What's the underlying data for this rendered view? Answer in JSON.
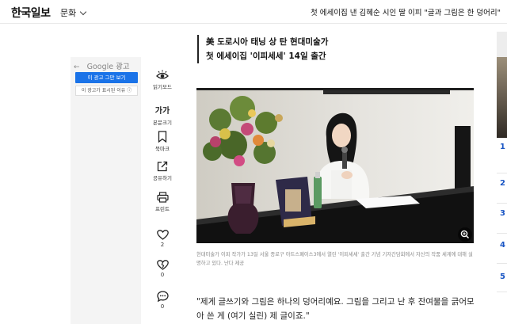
{
  "header": {
    "logo": "한국일보",
    "section": "문화",
    "headline": "첫 에세이집 낸 김혜순 시인 딸 이피 \"글과 그림은 한 덩어리\""
  },
  "ad": {
    "brand": "Google",
    "label": "광고",
    "stop_button": "이 광고 그만 보기",
    "why_button": "이 광고가 표시된 이유 ⓘ"
  },
  "tools": {
    "reading_mode": "읽기모드",
    "font_size_glyph": "가가",
    "font_size": "본문크기",
    "bookmark": "북마크",
    "share": "공유하기",
    "print": "프린트",
    "like_count": "2",
    "heart_count": "0",
    "comment_count": "0"
  },
  "article": {
    "subtitle_line1": "美 도로시아 태닝 상 탄 현대미술가",
    "subtitle_line2": "첫 에세이집 '이피세세' 14일 출간",
    "caption": "현대미술가 이피 작가가 13일 서울 종로구 아트스페이스3에서 열린 '이피세세' 출간 기념 기자간담회에서 자신의 작품 세계에 대해 설명하고 있다. 난다 제공",
    "body": "\"제게 글쓰기와 그림은 하나의 덩어리예요. 그림을 그리고 난 후 잔여물을 긁어모아 쓴 게 (여기 실린) 제 글이죠.\""
  },
  "right_rail": {
    "numbers": [
      "1",
      "2",
      "3",
      "4",
      "5"
    ]
  },
  "colors": {
    "accent_blue": "#1a73e8",
    "rank_blue": "#1a56c4"
  }
}
